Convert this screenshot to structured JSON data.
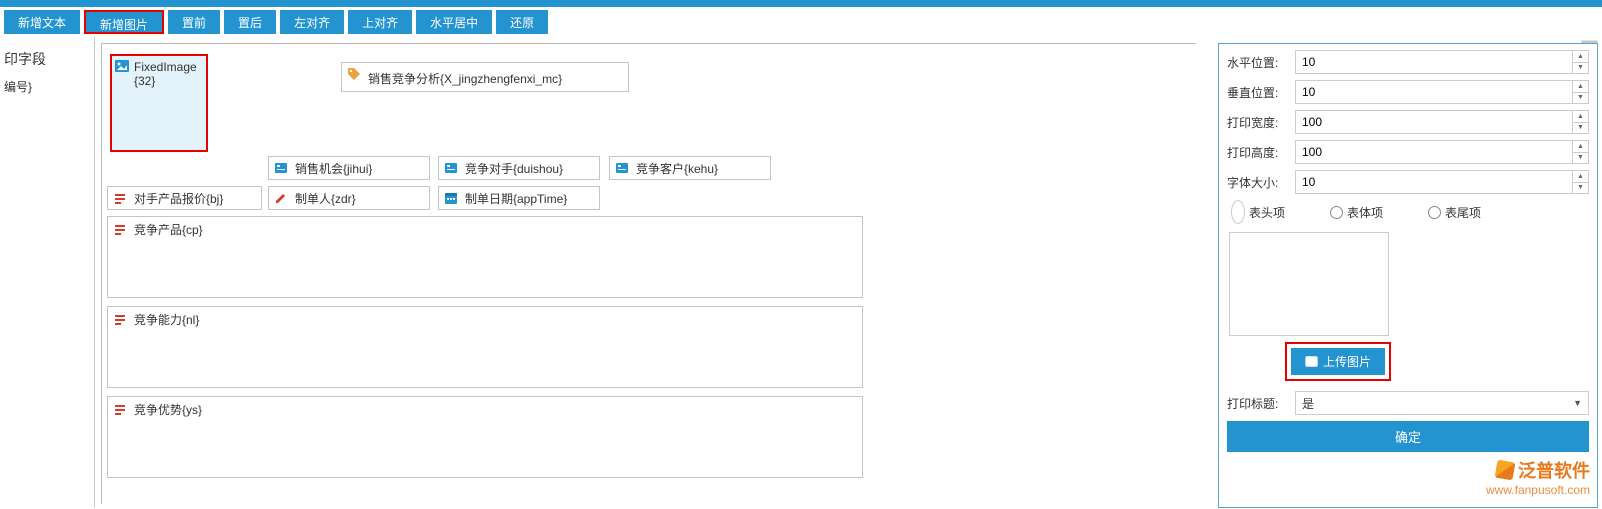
{
  "toolbar": {
    "addText": "新增文本",
    "addImage": "新增图片",
    "bringFront": "置前",
    "sendBack": "置后",
    "alignLeft": "左对齐",
    "alignTop": "上对齐",
    "centerH": "水平居中",
    "restore": "还原"
  },
  "leftPanel": {
    "title": "印字段",
    "item1": "编号}"
  },
  "canvas": {
    "imageBlock": "FixedImage{32}",
    "titleField": "销售竞争分析{X_jingzhengfenxi_mc}",
    "fields": {
      "jihui": "销售机会{jihui}",
      "duishou": "竞争对手{duishou}",
      "kehu": "竞争客户{kehu}",
      "bj": "对手产品报价{bj}",
      "zdr": "制单人{zdr}",
      "appTime": "制单日期{appTime}",
      "cp": "竞争产品{cp}",
      "nl": "竞争能力{nl}",
      "ys": "竞争优势{ys}"
    }
  },
  "props": {
    "hPosLabel": "水平位置:",
    "hPos": "10",
    "vPosLabel": "垂直位置:",
    "vPos": "10",
    "pWidthLabel": "打印宽度:",
    "pWidth": "100",
    "pHeightLabel": "打印高度:",
    "pHeight": "100",
    "fontSizeLabel": "字体大小:",
    "fontSize": "10",
    "radio1": "表头项",
    "radio2": "表体项",
    "radio3": "表尾项",
    "uploadLabel": "上传图片",
    "printTitleLabel": "打印标题:",
    "printTitleValue": "是",
    "confirm": "确定"
  },
  "watermark": {
    "brand": "泛普软件",
    "url": "www.fanpusoft.com"
  }
}
